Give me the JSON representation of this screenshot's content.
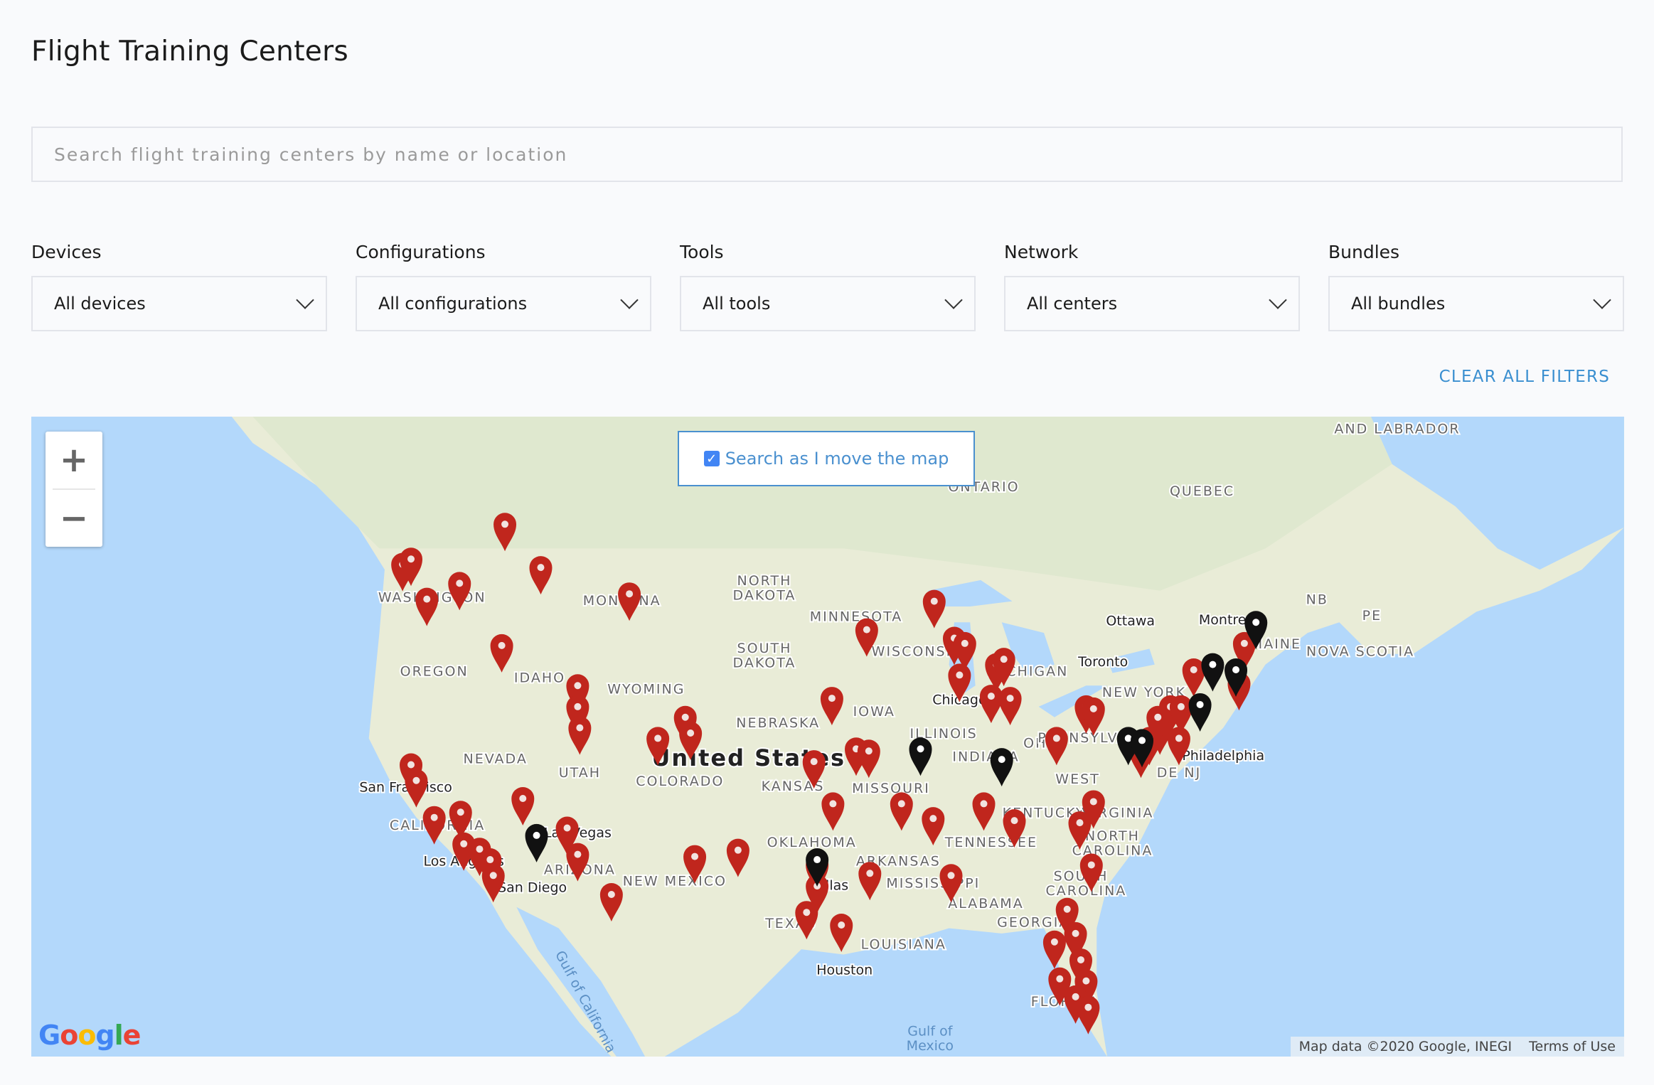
{
  "page": {
    "title": "Flight Training Centers"
  },
  "search": {
    "placeholder": "Search flight training centers by name or location",
    "value": ""
  },
  "filters": [
    {
      "label": "Devices",
      "value": "All devices"
    },
    {
      "label": "Configurations",
      "value": "All configurations"
    },
    {
      "label": "Tools",
      "value": "All tools"
    },
    {
      "label": "Network",
      "value": "All centers"
    },
    {
      "label": "Bundles",
      "value": "All bundles"
    }
  ],
  "clear_filters_label": "CLEAR ALL FILTERS",
  "map": {
    "zoom_in": "+",
    "zoom_out": "−",
    "search_as_move": {
      "label": "Search as I move the map",
      "checked": true
    },
    "logo": "Google",
    "attribution": "Map data ©2020 Google, INEGI",
    "terms": "Terms of Use",
    "colors": {
      "ocean": "#b3d8fb",
      "land": "#e9ecd7",
      "pin_red": "#c0261d",
      "pin_black": "#111111",
      "accent": "#4a90cf"
    },
    "labels": [
      "AND LABRADOR",
      "ONTARIO",
      "QUEBEC",
      "NB",
      "PE",
      "NOVA SCOTIA",
      "Ottawa",
      "Montreal",
      "Toronto",
      "NORTH",
      "DAKOTA",
      "SOUTH",
      "DAKOTA",
      "MINNESOTA",
      "WISCONSIN",
      "MICHIGAN",
      "IOWA",
      "NEBRASKA",
      "ILLINOIS",
      "INDIANA",
      "OHIO",
      "WASHINGTON",
      "OREGON",
      "IDAHO",
      "MONTANA",
      "WYOMING",
      "NEVADA",
      "UTAH",
      "COLORADO",
      "KANSAS",
      "MISSOURI",
      "United States",
      "San Francisco",
      "CALIFORNIA",
      "Los Angeles",
      "Las Vegas",
      "ARIZONA",
      "San Diego",
      "NEW MEXICO",
      "OKLAHOMA",
      "ARKANSAS",
      "MISSISSIPPI",
      "ALABAMA",
      "TENNESSEE",
      "KENTUCKY",
      "WEST",
      "VIRGINIA",
      "NORTH",
      "CAROLINA",
      "SOUTH",
      "CAROLINA",
      "GEORGIA",
      "FLORIDA",
      "TEXAS",
      "LOUISIANA",
      "Houston",
      "Dallas",
      "Chicago",
      "Philadelphia",
      "NEW YORK",
      "PENNSYLVANIA",
      "MAINE",
      "DE NJ",
      "Gulf of",
      "Mexico",
      "Gulf of California"
    ]
  }
}
